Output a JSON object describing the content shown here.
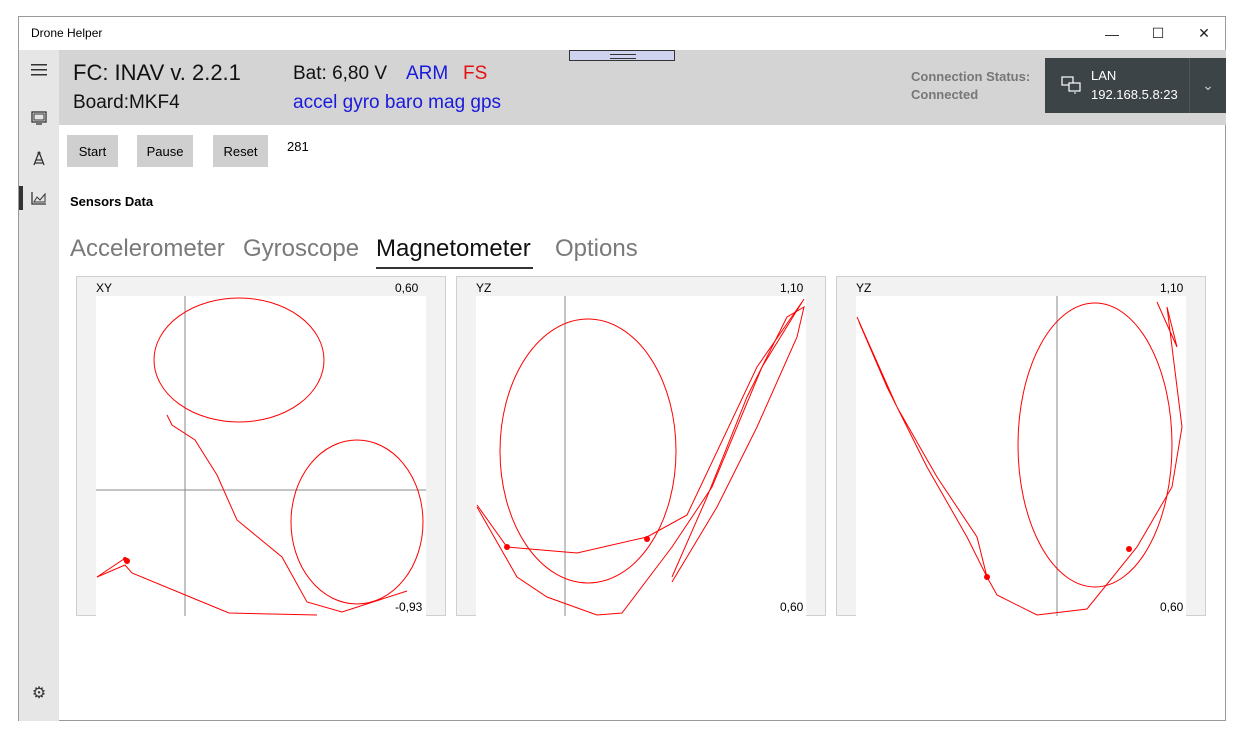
{
  "window": {
    "title": "Drone Helper"
  },
  "controls": {
    "minimize": "—",
    "maximize": "☐",
    "close": "✕"
  },
  "nav": {
    "menu_icon": "hamburger-icon",
    "items": [
      "monitor-icon",
      "tower-icon",
      "chart-icon"
    ],
    "settings_icon": "gear-icon"
  },
  "header": {
    "fc": "FC: INAV v. 2.2.1",
    "board": "Board:MKF4",
    "bat": "Bat:  6,80 V",
    "arm": "ARM",
    "fs": "FS",
    "sensors": "accel gyro baro mag gps",
    "conn_label": "Connection Status:",
    "conn_value": "Connected",
    "lan_name": "LAN",
    "lan_addr": "192.168.5.8:23"
  },
  "toolbar": {
    "start": "Start",
    "pause": "Pause",
    "reset": "Reset",
    "counter": "281"
  },
  "section_title": "Sensors Data",
  "tabs": [
    {
      "label": "Accelerometer",
      "active": false
    },
    {
      "label": "Gyroscope",
      "active": false
    },
    {
      "label": "Magnetometer",
      "active": true
    },
    {
      "label": "Options",
      "active": false
    }
  ],
  "colors": {
    "header_bg": "#d4d4d4",
    "accent_blue": "#1a1adc",
    "alert_red": "#e21212",
    "trace_red": "#ff0000",
    "lan_bg": "#3d4447"
  },
  "chart_data": [
    {
      "type": "line",
      "axis": "XY",
      "top_label": "0,60",
      "bottom_label": "-0,93",
      "series": [
        {
          "name": "",
          "points": []
        }
      ]
    },
    {
      "type": "line",
      "axis": "YZ",
      "top_label": "1,10",
      "bottom_label": "0,60",
      "series": [
        {
          "name": "",
          "points": []
        }
      ]
    },
    {
      "type": "line",
      "axis": "YZ",
      "top_label": "1,10",
      "bottom_label": "0,60",
      "series": [
        {
          "name": "",
          "points": []
        }
      ]
    }
  ]
}
